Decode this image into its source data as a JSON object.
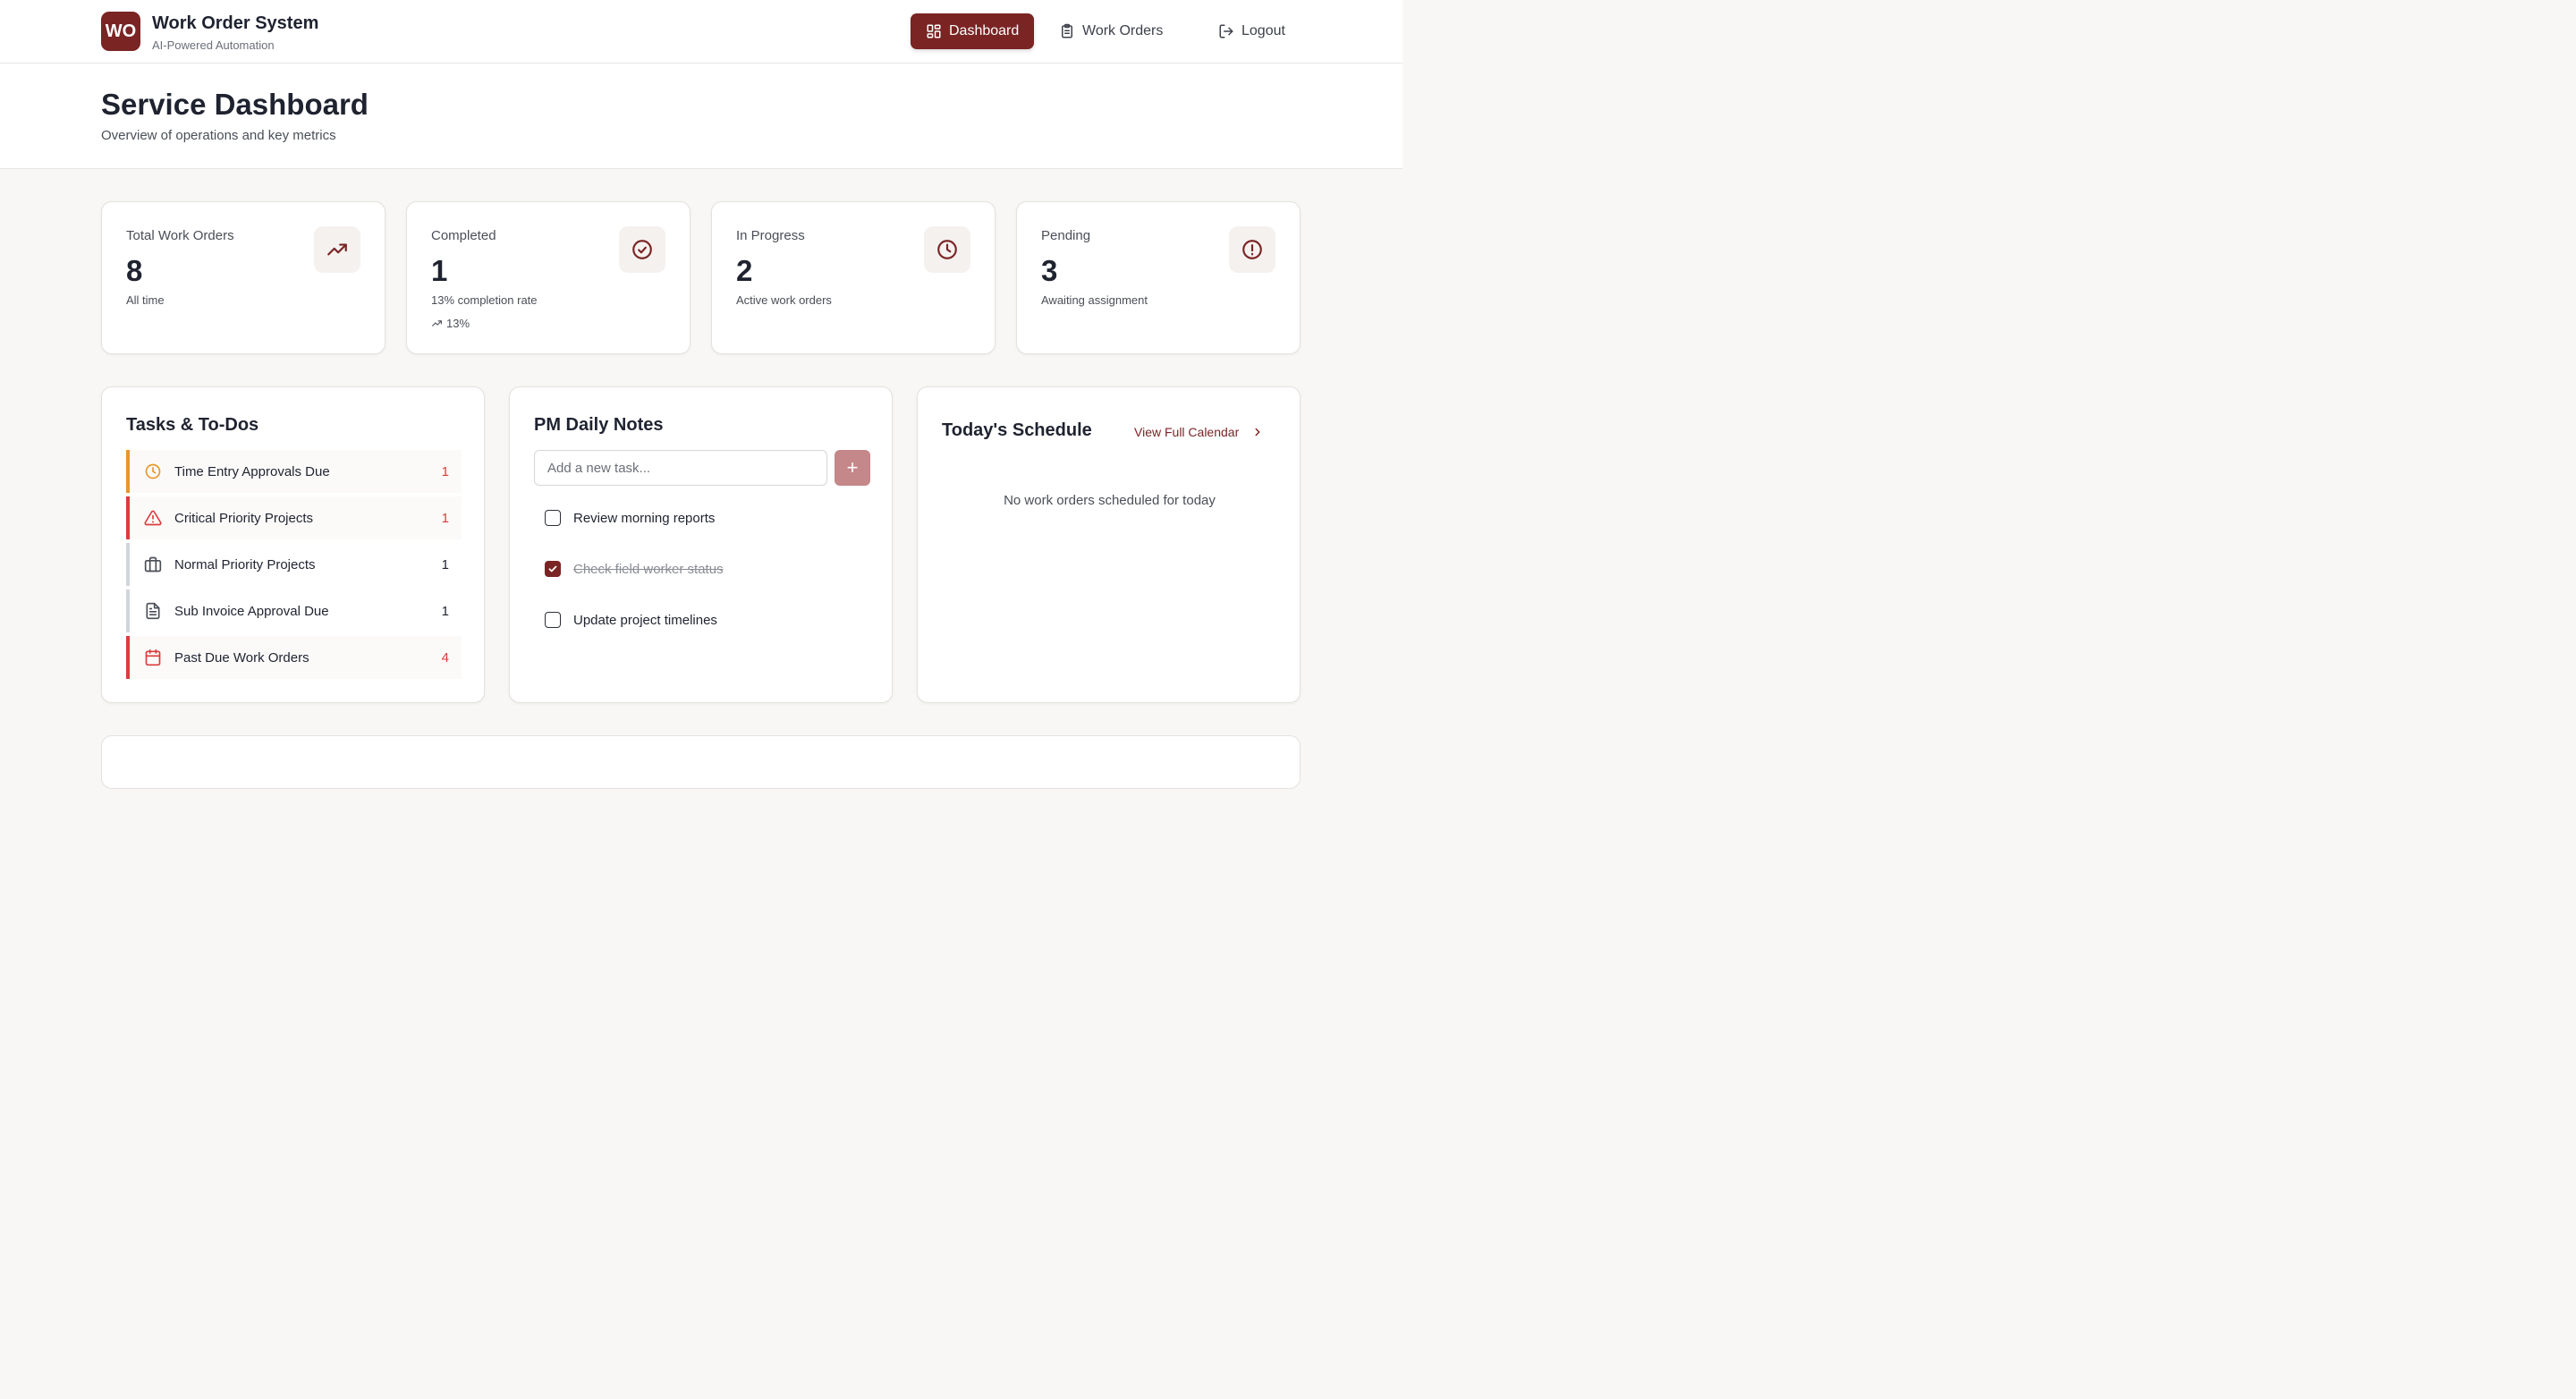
{
  "app": {
    "logo_text": "WO",
    "title": "Work Order System",
    "subtitle": "AI-Powered Automation"
  },
  "nav": {
    "dashboard": "Dashboard",
    "work_orders": "Work Orders",
    "logout": "Logout"
  },
  "page": {
    "title": "Service Dashboard",
    "subtitle": "Overview of operations and key metrics"
  },
  "stats": [
    {
      "label": "Total Work Orders",
      "value": "8",
      "caption": "All time",
      "icon": "trending-up-icon"
    },
    {
      "label": "Completed",
      "value": "1",
      "caption": "13% completion rate",
      "trend": "13%",
      "icon": "check-circle-icon"
    },
    {
      "label": "In Progress",
      "value": "2",
      "caption": "Active work orders",
      "icon": "clock-icon"
    },
    {
      "label": "Pending",
      "value": "3",
      "caption": "Awaiting assignment",
      "icon": "alert-circle-icon"
    }
  ],
  "tasks": {
    "title": "Tasks & To-Dos",
    "items": [
      {
        "label": "Time Entry Approvals Due",
        "count": "1",
        "icon": "clock-icon",
        "accent": "#e8962c"
      },
      {
        "label": "Critical Priority Projects",
        "count": "1",
        "icon": "warning-triangle-icon",
        "accent": "#dc3b3b"
      },
      {
        "label": "Normal Priority Projects",
        "count": "1",
        "icon": "briefcase-icon",
        "accent": "#d1d5db"
      },
      {
        "label": "Sub Invoice Approval Due",
        "count": "1",
        "icon": "document-icon",
        "accent": "#d1d5db"
      },
      {
        "label": "Past Due Work Orders",
        "count": "4",
        "icon": "calendar-icon",
        "accent": "#dc3b3b"
      }
    ]
  },
  "notes": {
    "title": "PM Daily Notes",
    "input_placeholder": "Add a new task...",
    "add_label": "+",
    "items": [
      {
        "text": "Review morning reports",
        "checked": false
      },
      {
        "text": "Check field worker status",
        "checked": true
      },
      {
        "text": "Update project timelines",
        "checked": false
      }
    ]
  },
  "schedule": {
    "title": "Today's Schedule",
    "link": "View Full Calendar",
    "empty": "No work orders scheduled for today"
  },
  "colors": {
    "brand": "#7a2424",
    "warning": "#e8962c",
    "critical": "#dc3b3b"
  }
}
